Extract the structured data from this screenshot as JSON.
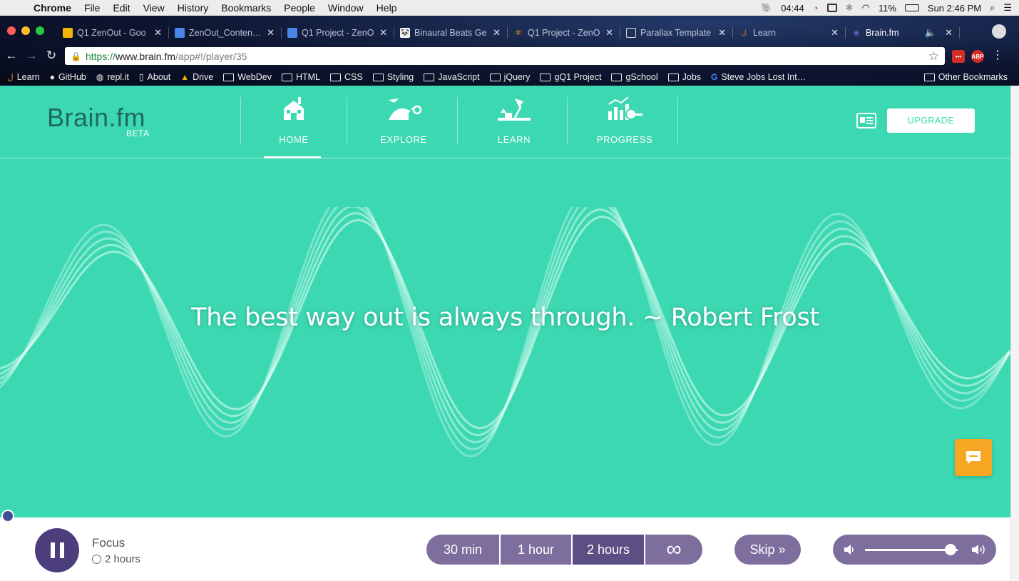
{
  "menubar": {
    "app": "Chrome",
    "items": [
      "File",
      "Edit",
      "View",
      "History",
      "Bookmarks",
      "People",
      "Window",
      "Help"
    ],
    "timer": "04:44",
    "battery": "11%",
    "clock": "Sun 2:46 PM"
  },
  "tabs": [
    {
      "title": "Q1 ZenOut - Goo",
      "icon_color": "#f4b400"
    },
    {
      "title": "ZenOut_Content In",
      "icon_color": "#4a86e8"
    },
    {
      "title": "Q1 Project - ZenO",
      "icon_color": "#4a86e8"
    },
    {
      "title": "Binaural Beats Ge",
      "icon_color": "#ffffff"
    },
    {
      "title": "Q1 Project - ZenO",
      "icon_color": "#e87722"
    },
    {
      "title": "Parallax Template",
      "icon_color": "#ffffff"
    },
    {
      "title": "Learn",
      "icon_color": "#e87722"
    },
    {
      "title": "Brain.fm",
      "icon_color": "#6a5acd"
    }
  ],
  "address": {
    "scheme": "https://",
    "host": "www.brain.fm",
    "path": "/app#!/player/35"
  },
  "bookmarks": [
    {
      "label": "Learn",
      "icon": "learn-icon"
    },
    {
      "label": "GitHub",
      "icon": "github-icon"
    },
    {
      "label": "repl.it",
      "icon": "replit-icon"
    },
    {
      "label": "About",
      "icon": "page-icon"
    },
    {
      "label": "Drive",
      "icon": "drive-icon"
    },
    {
      "label": "WebDev",
      "icon": "folder-icon"
    },
    {
      "label": "HTML",
      "icon": "folder-icon"
    },
    {
      "label": "CSS",
      "icon": "folder-icon"
    },
    {
      "label": "Styling",
      "icon": "folder-icon"
    },
    {
      "label": "JavaScript",
      "icon": "folder-icon"
    },
    {
      "label": "jQuery",
      "icon": "folder-icon"
    },
    {
      "label": "gQ1 Project",
      "icon": "folder-icon"
    },
    {
      "label": "gSchool",
      "icon": "folder-icon"
    },
    {
      "label": "Jobs",
      "icon": "folder-icon"
    },
    {
      "label": "Steve Jobs Lost Int…",
      "icon": "google-icon"
    }
  ],
  "other_bookmarks": "Other Bookmarks",
  "app": {
    "logo": "Brain.fm",
    "beta": "BETA",
    "nav": [
      {
        "label": "HOME",
        "icon": "home-icon"
      },
      {
        "label": "EXPLORE",
        "icon": "explore-icon"
      },
      {
        "label": "LEARN",
        "icon": "learn-lamp-icon"
      },
      {
        "label": "PROGRESS",
        "icon": "progress-chart-icon"
      }
    ],
    "active_nav": "HOME",
    "upgrade_label": "UPGRADE",
    "quote": "The best way out is always through. ~ Robert Frost"
  },
  "player": {
    "track_name": "Focus",
    "duration": "2 hours",
    "timers": [
      "30 min",
      "1 hour",
      "2 hours",
      "∞"
    ],
    "selected_timer": "2 hours",
    "skip_label": "Skip »",
    "volume": 0.92
  },
  "colors": {
    "app_bg": "#3cd8b2",
    "logo": "#1e6b5c",
    "button_purple": "#7d6e9d",
    "pause_button": "#4c3e7d",
    "chat_orange": "#f6a623"
  }
}
